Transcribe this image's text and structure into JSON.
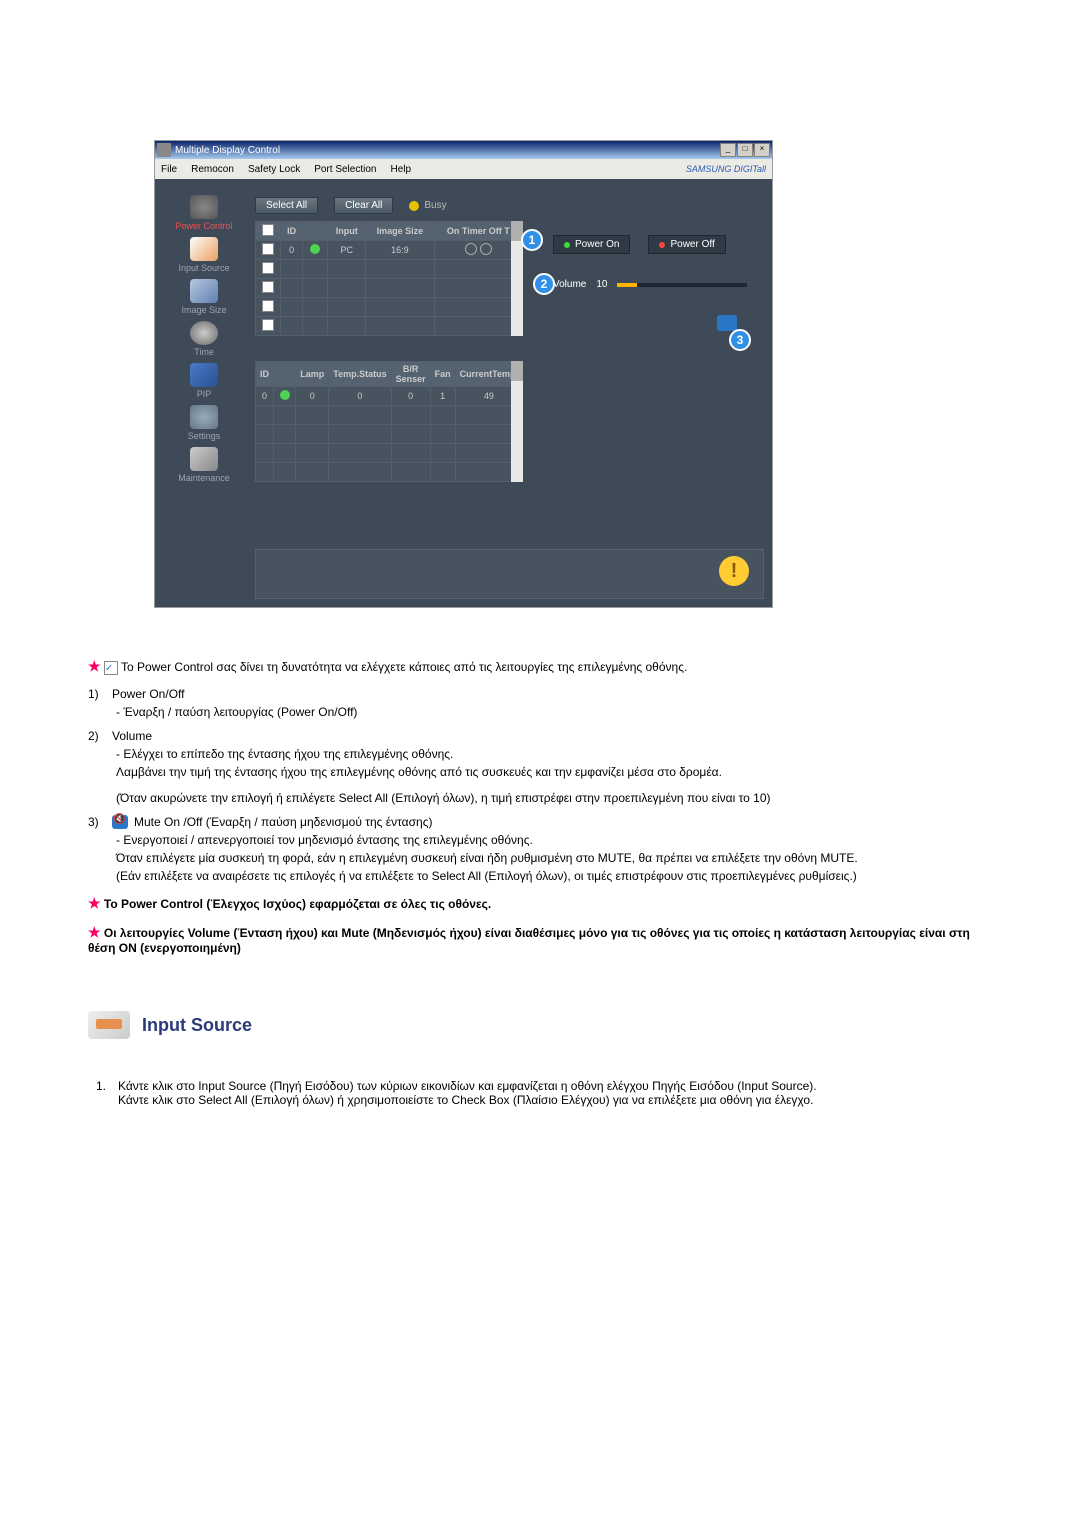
{
  "screenshot": {
    "title": "Multiple Display Control",
    "menu": [
      "File",
      "Remocon",
      "Safety Lock",
      "Port Selection",
      "Help"
    ],
    "brand": "SAMSUNG DIGITall",
    "toolbar": {
      "select_all": "Select All",
      "clear_all": "Clear All",
      "busy": "Busy"
    },
    "sidebar": [
      {
        "label": "Power Control"
      },
      {
        "label": "Input Source"
      },
      {
        "label": "Image Size"
      },
      {
        "label": "Time"
      },
      {
        "label": "PIP"
      },
      {
        "label": "Settings"
      },
      {
        "label": "Maintenance"
      }
    ],
    "table1": {
      "headers": [
        "",
        "ID",
        "",
        "Input",
        "Image Size",
        "On Timer Off T"
      ],
      "row": {
        "id": "0",
        "input": "PC",
        "image_size": "16:9"
      }
    },
    "table2": {
      "headers": [
        "ID",
        "",
        "Lamp",
        "Temp.Status",
        "B/R Senser",
        "Fan",
        "CurrentTemp."
      ],
      "row": {
        "id": "0",
        "lamp": "0",
        "temp_status": "0",
        "br": "0",
        "fan": "1",
        "ctemp": "49"
      }
    },
    "power": {
      "on": "Power On",
      "off": "Power Off"
    },
    "volume": {
      "label": "Volume",
      "value": "10"
    },
    "callouts": {
      "c1": "1",
      "c2": "2",
      "c3": "3"
    }
  },
  "body": {
    "intro": "Το Power Control σας δίνει τη δυνατότητα να ελέγχετε κάποιες από τις λειτουργίες της επιλεγμένης οθόνης.",
    "n1": {
      "num": "1)",
      "title": "Power On/Off",
      "line": "- Έναρξη / παύση λειτουργίας (Power On/Off)"
    },
    "n2": {
      "num": "2)",
      "title": "Volume",
      "l1": "- Ελέγχει το επίπεδο της έντασης ήχου της επιλεγμένης οθόνης.",
      "l2": "Λαμβάνει την τιμή της έντασης ήχου της επιλεγμένης οθόνης από τις συσκευές και την εμφανίζει μέσα στο δρομέα.",
      "l3": "(Όταν ακυρώνετε την επιλογή ή επιλέγετε Select All (Επιλογή όλων), η τιμή επιστρέφει στην προεπιλεγμένη που είναι το 10)"
    },
    "n3": {
      "num": "3)",
      "title": "Mute On /Off (Έναρξη / παύση μηδενισμού της έντασης)",
      "l1": "- Ενεργοποιεί / απενεργοποιεί τον μηδενισμό έντασης της επιλεγμένης οθόνης.",
      "l2": "Όταν επιλέγετε μία συσκευή τη φορά, εάν η επιλεγμένη συσκευή είναι ήδη ρυθμισμένη στο MUTE, θα πρέπει να επιλέξετε την οθόνη MUTE.",
      "l3": "(Εάν επιλέξετε να αναιρέσετε τις επιλογές ή να επιλέξετε το Select All (Επιλογή όλων), οι τιμές επιστρέφουν στις προεπιλεγμένες ρυθμίσεις.)"
    },
    "note1": "Το Power Control (Έλεγχος Ισχύος) εφαρμόζεται σε όλες τις οθόνες.",
    "note2": "Οι λειτουργίες Volume (Ένταση ήχου) και Mute (Μηδενισμός ήχου) είναι διαθέσιμες μόνο για τις οθόνες για τις οποίες η κατάσταση λειτουργίας είναι στη θέση ON (ενεργοποιημένη)"
  },
  "section2": {
    "title": "Input Source",
    "n1_num": "1.",
    "n1_l1": "Κάντε κλικ στο Input Source (Πηγή Εισόδου) των κύριων εικονιδίων και εμφανίζεται η οθόνη ελέγχου Πηγής Εισόδου (Input Source).",
    "n1_l2": "Κάντε κλικ στο Select All (Επιλογή όλων) ή χρησιμοποιείστε το Check Box (Πλαίσιο Ελέγχου) για να επιλέξετε μια οθόνη για έλεγχο."
  }
}
